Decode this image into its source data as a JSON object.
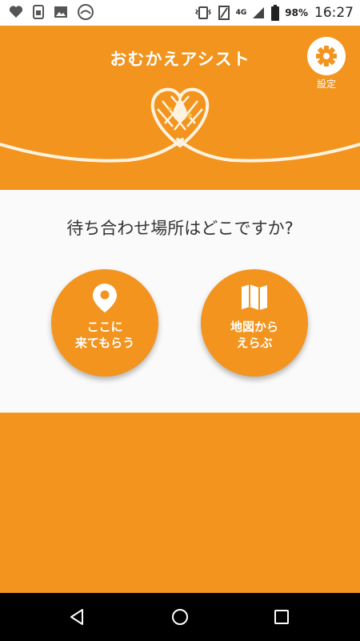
{
  "status_bar": {
    "network": "4G",
    "battery_percent": "98%",
    "time": "16:27",
    "icons_left": [
      "heart-icon",
      "sim-card-icon",
      "image-icon",
      "sync-icon"
    ],
    "icons_right": [
      "vibrate-icon",
      "screenshot-icon",
      "signal-icon",
      "battery-icon"
    ]
  },
  "header": {
    "title": "おむかえアシスト",
    "settings_label": "設定",
    "settings_icon": "gear-icon"
  },
  "main": {
    "question": "待ち合わせ場所はどこですか?",
    "buttons": [
      {
        "line1": "ここに",
        "line2": "来てもらう",
        "icon": "location-pin-icon"
      },
      {
        "line1": "地図から",
        "line2": "えらぶ",
        "icon": "map-icon"
      }
    ]
  },
  "nav": {
    "buttons": [
      "back-icon",
      "home-icon",
      "recents-icon"
    ]
  },
  "colors": {
    "accent": "#f2941e",
    "panel": "#fafafa",
    "status_bar": "#ffffff",
    "nav_bar": "#000000"
  }
}
